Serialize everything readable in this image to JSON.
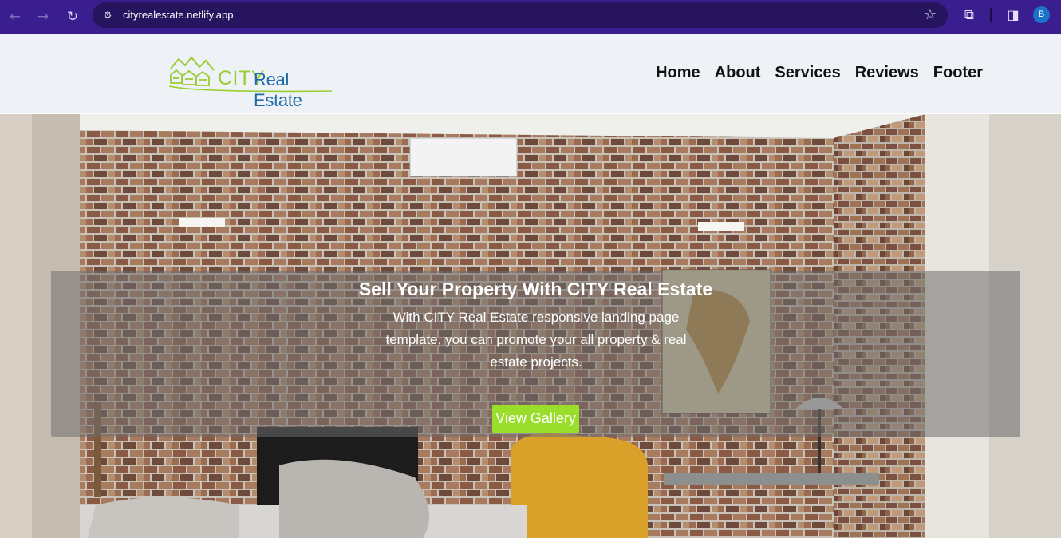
{
  "browser": {
    "back_icon": "arrow-left-icon",
    "forward_icon": "arrow-right-icon",
    "reload_icon": "reload-icon",
    "url": "cityrealestate.netlify.app",
    "profile_initial": "B",
    "colors": {
      "toolbar": "#3a1d8f",
      "omnibox": "#27145f",
      "profile": "#1a73c9"
    }
  },
  "header": {
    "logo": {
      "city": "CITY",
      "real_estate": "Real Estate"
    },
    "nav": [
      "Home",
      "About",
      "Services",
      "Reviews",
      "Footer"
    ]
  },
  "hero": {
    "title": "Sell Your Property With CITY Real Estate",
    "text": "With CITY Real Estate responsive landing page template, you can promote your all property & real estate projects.",
    "button": "View Gallery",
    "colors": {
      "button": "#9ade2c",
      "overlay": "rgba(110,110,110,0.55)"
    }
  },
  "colors": {
    "logo_green": "#9acd32",
    "logo_blue": "#1e6aa8",
    "header_bg": "#eef2f7"
  }
}
